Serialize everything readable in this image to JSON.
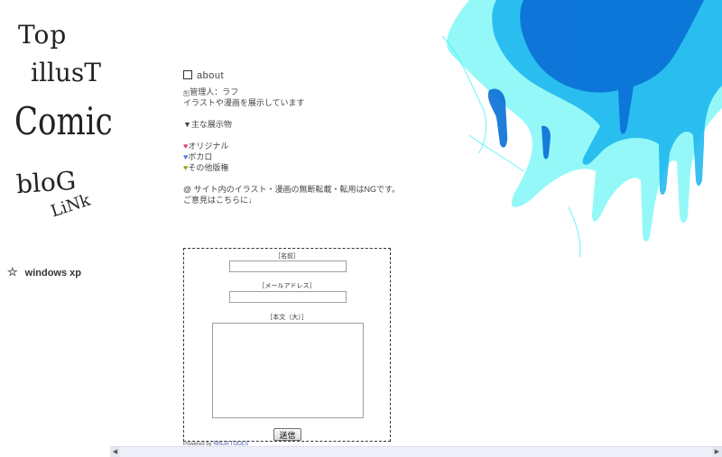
{
  "nav": {
    "top": "Top",
    "illust": "illusT",
    "comic": "Comic",
    "blog": "bloG",
    "link": "LiNk"
  },
  "sidebar": {
    "windows_xp": "windows xp"
  },
  "about": {
    "title": "about",
    "admin": "管理人：ラフ",
    "description": "イラストや漫画を展示しています",
    "main_heading": "▼主な展示物",
    "items": [
      "オリジナル",
      "ボカロ",
      "その他版権"
    ],
    "notice": "サイト内のイラスト・漫画の無断転載・転用はNGです。",
    "contact": "ご意見はこちらに↓"
  },
  "form": {
    "name_label": "［名前］",
    "email_label": "［メールアドレス］",
    "body_label": "［本文（大）］",
    "submit": "送信",
    "powered_prefix": "Powered by",
    "powered_link": "NINJA TOOLS"
  },
  "colors": {
    "splash_dark": "#0a6fd6",
    "splash_mid": "#18b4ee",
    "splash_light": "#3ef2f2"
  }
}
